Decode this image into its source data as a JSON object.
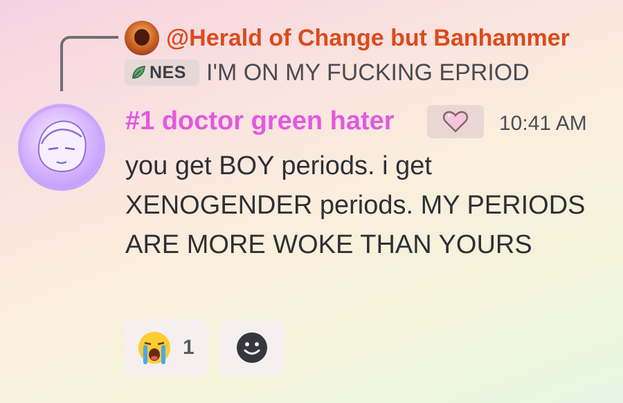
{
  "reply": {
    "author": "@Herald of Change but Banhammer",
    "author_color": "#dc4a1c",
    "tag": "NES",
    "tag_icon": "leaf-icon",
    "text": "I'M ON MY FUCKING EPRIOD"
  },
  "message": {
    "author": "#1 doctor green hater",
    "author_color": "#e458e0",
    "badge_icon": "pixel-heart-icon",
    "timestamp": "10:41 AM",
    "content": "you get BOY periods. i get XENOGENDER periods. MY PERIODS ARE MORE WOKE THAN YOURS"
  },
  "reactions": [
    {
      "emoji": "loudly-crying-face",
      "count": "1"
    }
  ],
  "add_reaction_icon": "smiley-face-icon"
}
